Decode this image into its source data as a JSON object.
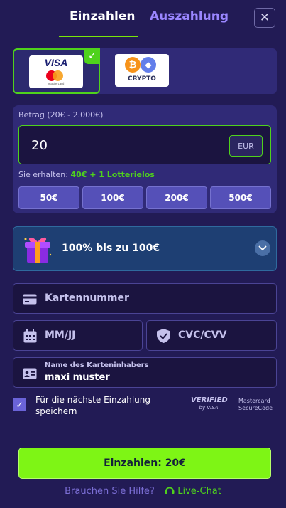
{
  "tabs": {
    "deposit": "Einzahlen",
    "withdraw": "Auszahlung"
  },
  "close_symbol": "✕",
  "payment_methods": {
    "visa": {
      "brand": "VISA",
      "sub": "mastercard",
      "selected": true,
      "check": "✓"
    },
    "crypto": {
      "label": "CRYPTO",
      "btc_symbol": "₿",
      "eth_symbol": "◆"
    }
  },
  "amount": {
    "label": "Betrag (20€ - 2.000€)",
    "value": "20",
    "currency": "EUR",
    "receive_prefix": "Sie erhalten:",
    "receive_value": "40€ + 1 Lotterielos",
    "presets": [
      "50€",
      "100€",
      "200€",
      "500€"
    ]
  },
  "bonus": {
    "text": "100% bis zu 100€"
  },
  "form": {
    "card_number_placeholder": "Kartennummer",
    "expiry_placeholder": "MM/JJ",
    "cvc_placeholder": "CVC/CVV",
    "holder_label": "Name des Karteninhabers",
    "holder_value": "maxi muster"
  },
  "save": {
    "label": "Für die nächste Einzahlung speichern",
    "checked": true,
    "check": "✓"
  },
  "badges": {
    "verified_top": "VERIFIED",
    "verified_bottom": "by VISA",
    "mc_top": "Mastercard",
    "mc_bottom": "SecureCode"
  },
  "deposit_button": "Einzahlen: 20€",
  "help": {
    "question": "Brauchen Sie Hilfe?",
    "chat": "Live-Chat"
  },
  "colors": {
    "accent": "#79e60a",
    "background": "#221b55",
    "link": "#9a86ff"
  }
}
